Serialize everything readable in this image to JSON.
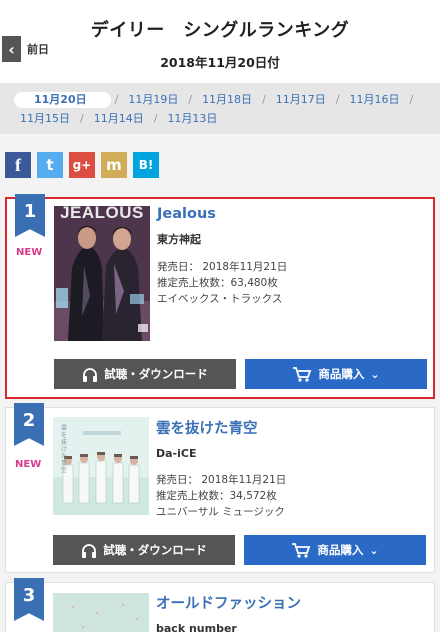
{
  "header": {
    "title": "デイリー　シングルランキング",
    "date": "2018年11月20日付",
    "back_label": "前日",
    "back_glyph": "‹"
  },
  "dates": [
    {
      "label": "11月20日",
      "active": true
    },
    {
      "label": "11月19日"
    },
    {
      "label": "11月18日"
    },
    {
      "label": "11月17日"
    },
    {
      "label": "11月16日"
    },
    {
      "label": "11月15日"
    },
    {
      "label": "11月14日"
    },
    {
      "label": "11月13日"
    }
  ],
  "separator": "/",
  "share": [
    {
      "name": "facebook",
      "glyph": "f",
      "color": "#3b5998"
    },
    {
      "name": "twitter",
      "glyph": "t",
      "color": "#55acee"
    },
    {
      "name": "google-plus",
      "glyph": "g+",
      "color": "#dc4e41"
    },
    {
      "name": "mixi",
      "glyph": "m",
      "color": "#d1ad59"
    },
    {
      "name": "hatena-bookmark",
      "glyph": "B!",
      "color": "#00a4de"
    }
  ],
  "buttons": {
    "listen": "試聴・ダウンロード",
    "buy": "商品購入",
    "buy_caret": "⌄"
  },
  "labels": {
    "new": "NEW",
    "release": "発売日：",
    "sales": "推定売上枚数：",
    "cover1_text": "JEALOUS",
    "cover2_text": "雲を抜けた青空"
  },
  "items": [
    {
      "rank": "1",
      "is_new": true,
      "title": "Jealous",
      "artist": "東方神起",
      "release": "2018年11月21日",
      "sales": "63,480枚",
      "label": "エイベックス・トラックス"
    },
    {
      "rank": "2",
      "is_new": true,
      "title": "雲を抜けた青空",
      "artist": "Da-iCE",
      "release": "2018年11月21日",
      "sales": "34,572枚",
      "label": "ユニバーサル ミュージック"
    },
    {
      "rank": "3",
      "title": "オールドファッション",
      "artist": "back number"
    }
  ],
  "colors": {
    "accent": "#3a71b6",
    "highlight_border": "#d8282f",
    "new": "#d83a8c",
    "buy": "#2a6ac6",
    "listen": "#555555"
  }
}
